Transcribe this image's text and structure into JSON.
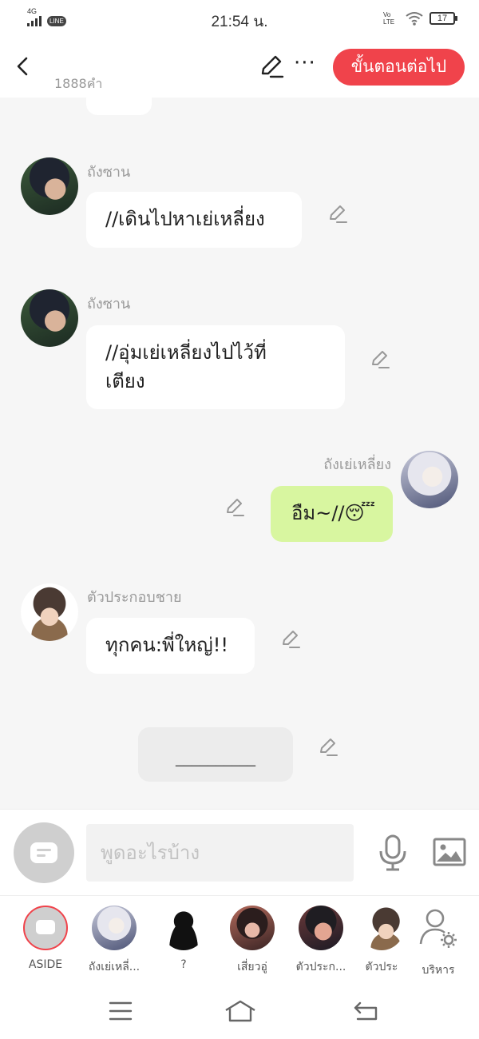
{
  "status_bar": {
    "time": "21:54 น.",
    "network": "4G",
    "line_badge": "LINE",
    "volte": "Vo LTE",
    "battery": "17"
  },
  "header": {
    "word_count": "1888คำ",
    "more_label": "···",
    "next_label": "ขั้นตอนต่อไป"
  },
  "messages": [
    {
      "speaker": "ถังซาน",
      "text": "//เดินไปหาเย่เหลี่ยง",
      "side": "left",
      "avatar": "boy-dark-hair-avatar"
    },
    {
      "speaker": "ถังซาน",
      "text_line1": "//อุ่มเย่เหลี่ยงไปไว้ที่",
      "text_line2": "เตียง",
      "side": "left",
      "avatar": "boy-dark-hair-avatar"
    },
    {
      "speaker": "ถังเย่เหลี่ยง",
      "text": "อืม~//",
      "emoji": "😴",
      "side": "right",
      "avatar": "white-hair-girl-avatar"
    },
    {
      "speaker": "ตัวประกอบชาย",
      "text": "ทุกคน:พี่ใหญ่!!",
      "side": "left",
      "avatar": "brown-hair-man-avatar"
    }
  ],
  "blank_bubble": {
    "text": "__________"
  },
  "composer": {
    "placeholder": "พูดอะไรบ้าง"
  },
  "roles": [
    {
      "label": "ASIDE",
      "avatar": "aside-icon"
    },
    {
      "label": "ถังเย่เหลี่...",
      "avatar": "white-hair-girl-avatar"
    },
    {
      "label": "?",
      "avatar": "silhouette-avatar"
    },
    {
      "label": "เสี่ยวอู่",
      "avatar": "girl-avatar"
    },
    {
      "label": "ตัวประก...",
      "avatar": "boy-avatar"
    },
    {
      "label": "ตัวประ",
      "avatar": "brown-hair-man-avatar"
    },
    {
      "label": "บริหาร",
      "avatar": "manage-user-gear-icon"
    }
  ],
  "colors": {
    "accent": "#f0434b",
    "my_bubble": "#d8f6a0",
    "chat_bg": "#f6f6f6"
  }
}
